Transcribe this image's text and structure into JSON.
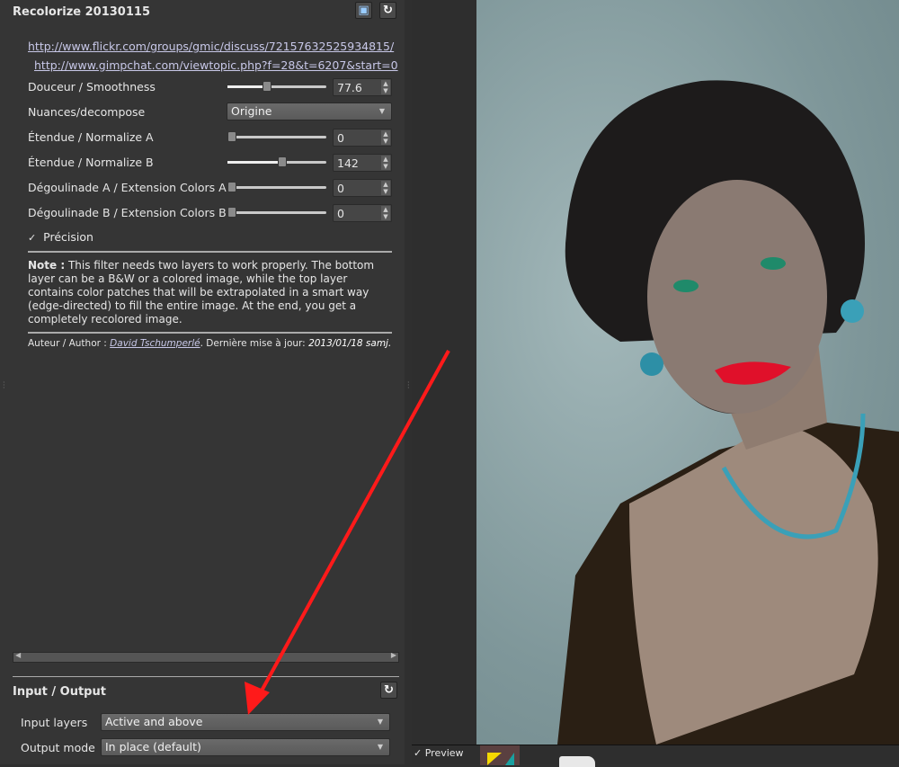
{
  "filter": {
    "title": "Recolorize 20130115",
    "links": [
      "http://www.flickr.com/groups/gmic/discuss/72157632525934815/",
      "http://www.gimpchat.com/viewtopic.php?f=28&t=6207&start=0"
    ],
    "params": [
      {
        "label": "Douceur / Smoothness",
        "value": "77.6",
        "fraction": 0.4
      },
      {
        "label": "Étendue / Normalize A",
        "value": "0",
        "fraction": 0
      },
      {
        "label": "Étendue / Normalize B",
        "value": "142",
        "fraction": 0.56
      },
      {
        "label": "Dégoulinade A / Extension Colors A",
        "value": "0",
        "fraction": 0
      },
      {
        "label": "Dégoulinade B / Extension Colors B",
        "value": "0",
        "fraction": 0
      }
    ],
    "nuances_label": "Nuances/decompose",
    "nuances_value": "Origine",
    "precision_label": "Précision",
    "note_bold": "Note :",
    "note_text": " This filter needs two layers to work properly. The bottom layer can be a B&W or a colored image, while the top layer contains color patches that will be extrapolated in a smart way (edge-directed) to fill the entire image. At the end, you get a completely recolored image.",
    "author_prefix": "Auteur / Author : ",
    "author_name": "David Tschumperlé",
    "author_mid": ". Dernière mise à jour: ",
    "author_date": "2013/01/18 samj."
  },
  "io": {
    "title": "Input / Output",
    "input_label": "Input layers",
    "input_value": "Active and above",
    "output_label": "Output mode",
    "output_value": "In place (default)"
  },
  "preview": {
    "label": "Preview",
    "checked": true
  },
  "colors": {
    "arrow": "#ff1a1a"
  }
}
